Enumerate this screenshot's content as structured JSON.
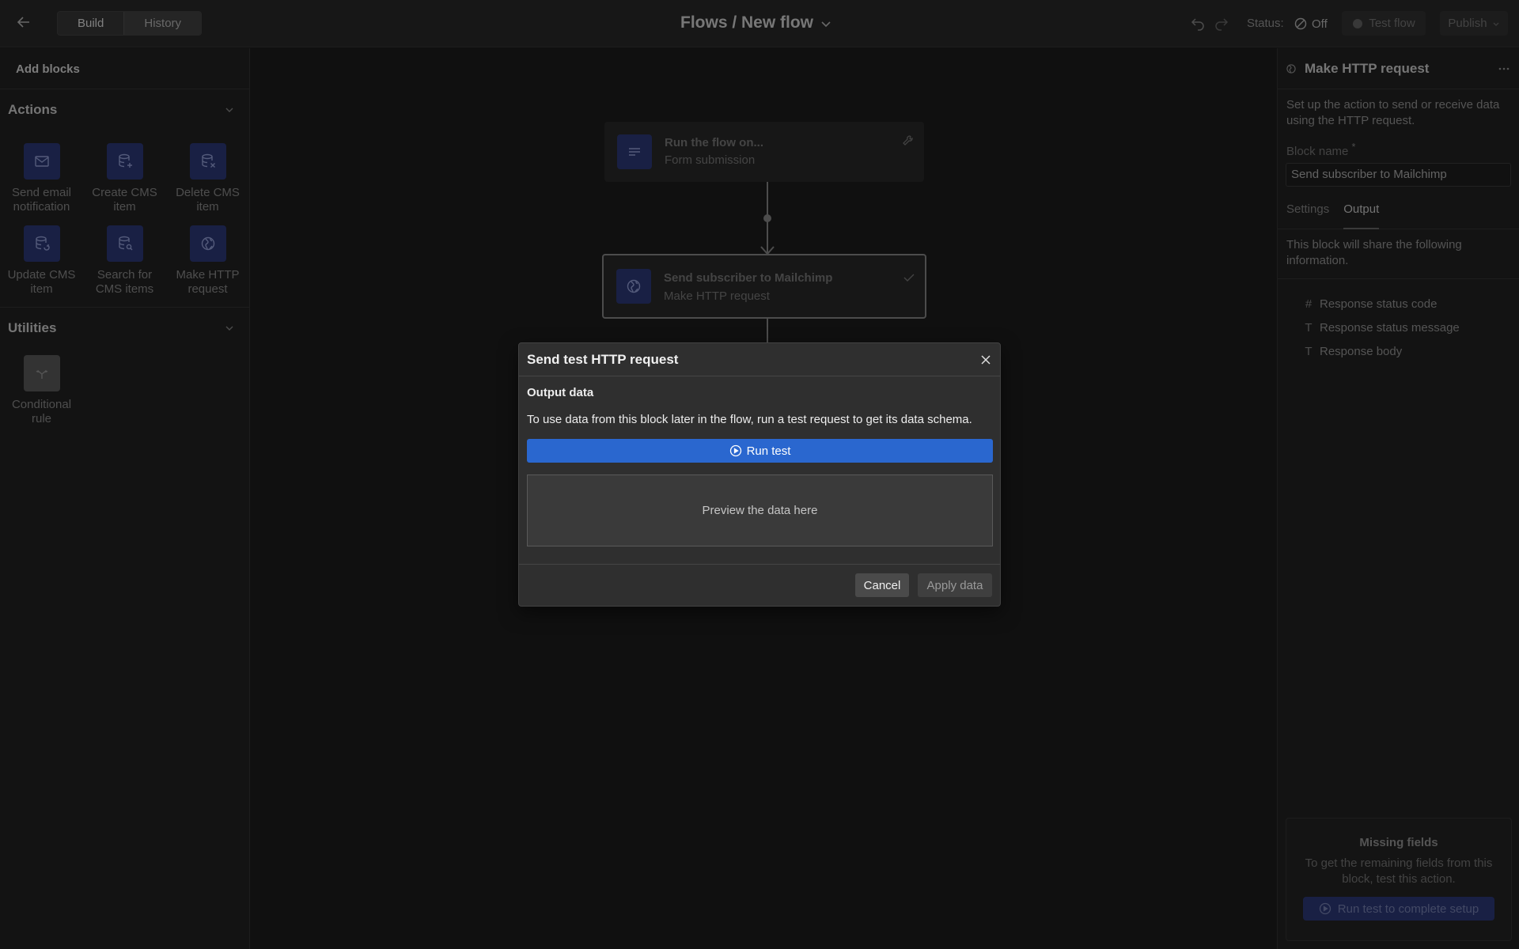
{
  "topbar": {
    "build_tab": "Build",
    "history_tab": "History",
    "flow_title": "Flows / New flow",
    "status_label": "Status:",
    "status_value": "Off",
    "test_flow_label": "Test flow",
    "publish_label": "Publish"
  },
  "left": {
    "header": "Add blocks",
    "actions_title": "Actions",
    "actions": [
      {
        "label": "Send email notification",
        "icon": "mail-icon"
      },
      {
        "label": "Create CMS item",
        "icon": "database-plus-icon"
      },
      {
        "label": "Delete CMS item",
        "icon": "database-x-icon"
      },
      {
        "label": "Update CMS item",
        "icon": "database-refresh-icon"
      },
      {
        "label": "Search for CMS items",
        "icon": "database-search-icon"
      },
      {
        "label": "Make HTTP request",
        "icon": "globe-icon"
      }
    ],
    "utilities_title": "Utilities",
    "utilities": [
      {
        "label": "Conditional rule",
        "icon": "branch-icon"
      }
    ]
  },
  "canvas": {
    "trigger": {
      "title": "Run the flow on...",
      "subtitle": "Form submission"
    },
    "action": {
      "title": "Send subscriber to Mailchimp",
      "subtitle": "Make HTTP request"
    }
  },
  "right": {
    "title": "Make HTTP request",
    "description": "Set up the action to send or receive data using the HTTP request.",
    "block_name_label": "Block name",
    "block_name_required": "*",
    "block_name_value": "Send subscriber to Mailchimp",
    "tabs": [
      "Settings",
      "Output"
    ],
    "share_text": "This block will share the following information.",
    "outputs": [
      {
        "type": "#",
        "label": "Response status code"
      },
      {
        "type": "T",
        "label": "Response status message"
      },
      {
        "type": "T",
        "label": "Response body"
      }
    ],
    "missing_title": "Missing fields",
    "missing_text": "To get the remaining fields from this block, test this action.",
    "missing_button": "Run test to complete setup"
  },
  "modal": {
    "title": "Send test HTTP request",
    "section": "Output data",
    "text": "To use data from this block later in the flow, run a test request to get its data schema.",
    "run_button": "Run test",
    "preview_placeholder": "Preview the data here",
    "cancel": "Cancel",
    "apply": "Apply data"
  },
  "colors": {
    "accent": "#2a67cf",
    "icon_bg": "#2e3b7d",
    "panel": "#232323",
    "canvas": "#1e1e1e"
  }
}
